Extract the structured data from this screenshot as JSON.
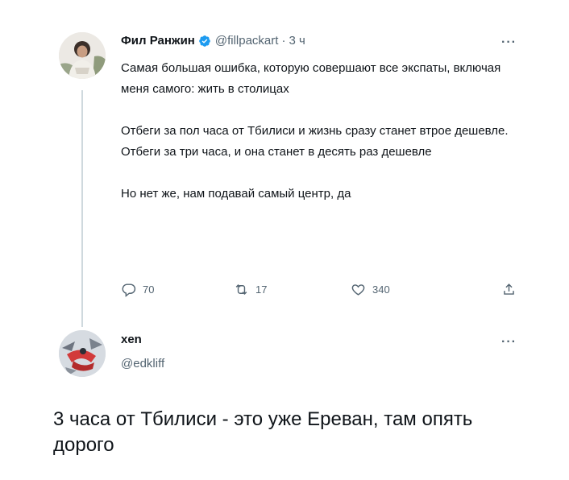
{
  "tweet": {
    "author_name": "Фил Ранжин",
    "author_handle": "@fillpackart",
    "separator": "·",
    "time": "3 ч",
    "more": "···",
    "paragraphs": [
      "Самая большая ошибка, которую совершают все экспаты, включая меня самого: жить в столицах",
      "Отбеги за пол часа от Тбилиси и жизнь сразу станет втрое дешевле. Отбеги за три часа, и она станет в десять раз дешевле",
      "Но нет же, нам подавай самый центр, да"
    ],
    "actions": {
      "replies": "70",
      "retweets": "17",
      "likes": "340"
    }
  },
  "reply": {
    "author_name": "xen",
    "author_handle": "@edkliff",
    "more": "···",
    "text": "3 часа от Тбилиси - это уже Ереван, там опять дорого"
  },
  "colors": {
    "text": "#0f1419",
    "secondary": "#536471",
    "verified": "#1d9bf0",
    "thread_line": "#cfd9de"
  },
  "icons": [
    "verified-badge-icon",
    "reply-icon",
    "retweet-icon",
    "like-icon",
    "share-icon",
    "more-icon"
  ]
}
